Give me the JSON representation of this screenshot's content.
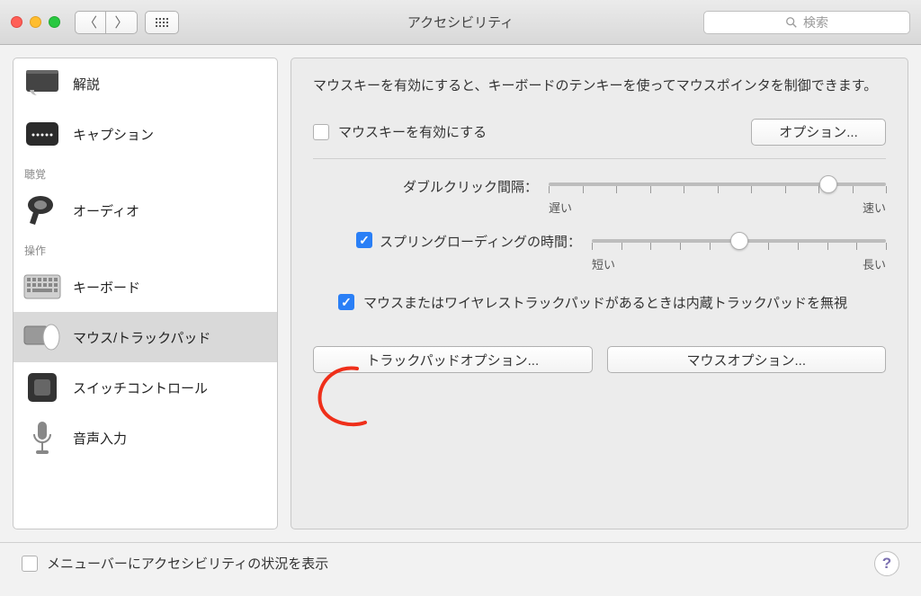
{
  "titlebar": {
    "title": "アクセシビリティ",
    "search_placeholder": "検索"
  },
  "sidebar": {
    "groups": [
      {
        "label": "聴覚",
        "after_index": 1
      },
      {
        "label": "操作",
        "after_index": 2
      }
    ],
    "items": [
      {
        "label": "解説",
        "icon": "narration"
      },
      {
        "label": "キャプション",
        "icon": "caption"
      },
      {
        "label": "オーディオ",
        "icon": "audio"
      },
      {
        "label": "キーボード",
        "icon": "keyboard"
      },
      {
        "label": "マウス/トラックパッド",
        "icon": "mouse",
        "selected": true
      },
      {
        "label": "スイッチコントロール",
        "icon": "switch"
      },
      {
        "label": "音声入力",
        "icon": "dictation"
      }
    ]
  },
  "main": {
    "intro": "マウスキーを有効にすると、キーボードのテンキーを使ってマウスポインタを制御できます。",
    "enable_mouse_keys_label": "マウスキーを有効にする",
    "enable_mouse_keys_checked": false,
    "options_button": "オプション...",
    "sliders": {
      "double_click": {
        "label": "ダブルクリック間隔：",
        "min_label": "遅い",
        "max_label": "速い",
        "value": 83,
        "ticks": 11,
        "has_checkbox": false
      },
      "spring_loading": {
        "label": "スプリングローディングの時間：",
        "min_label": "短い",
        "max_label": "長い",
        "value": 50,
        "ticks": 11,
        "has_checkbox": true,
        "checked": true
      }
    },
    "ignore_trackpad": {
      "label": "マウスまたはワイヤレストラックパッドがあるときは内蔵トラックパッドを無視",
      "checked": true
    },
    "trackpad_options_button": "トラックパッドオプション...",
    "mouse_options_button": "マウスオプション..."
  },
  "footer": {
    "menubar_status_label": "メニューバーにアクセシビリティの状況を表示",
    "menubar_status_checked": false
  }
}
